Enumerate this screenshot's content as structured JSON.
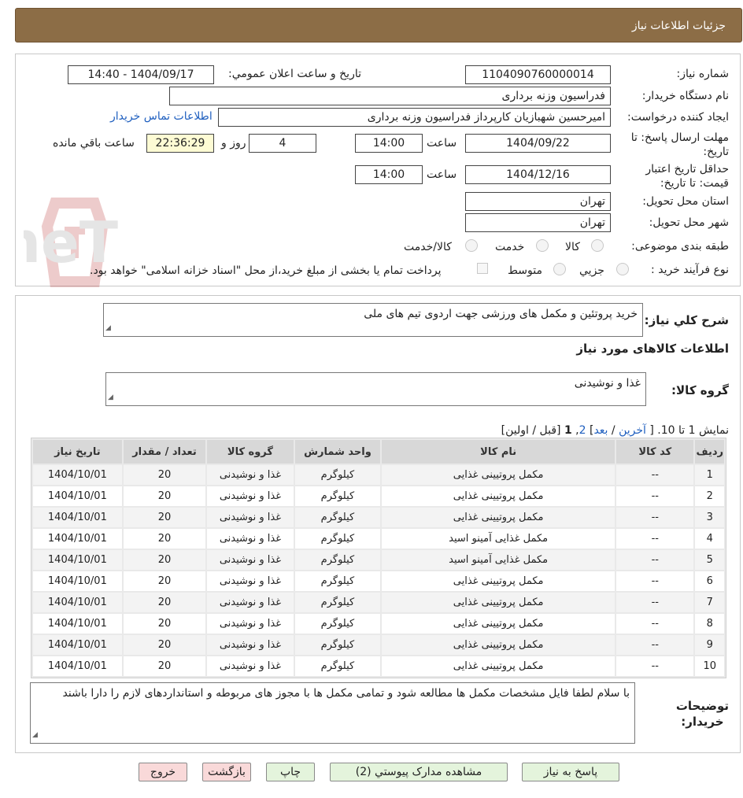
{
  "header": {
    "title": "جزئیات اطلاعات نیاز"
  },
  "form": {
    "need_number_label": "شماره نیاز:",
    "need_number": "1104090760000014",
    "announce_label": "تاریخ و ساعت اعلان عمومي:",
    "announce_value": "1404/09/17 - 14:40",
    "buyer_org_label": "نام دستگاه خريدار:",
    "buyer_org": "فدراسیون وزنه برداری",
    "requester_label": "ايجاد کننده درخواست:",
    "requester": "امیرحسین شهبازیان کارپرداز فدراسیون وزنه برداری",
    "contact_link": "اطلاعات تماس خريدار",
    "reply_deadline_label_1": "مهلت ارسال پاسخ: تا",
    "reply_deadline_label_2": "تاريخ:",
    "reply_date": "1404/09/22",
    "time_label": "ساعت",
    "reply_time": "14:00",
    "days_value": "4",
    "days_label": "روز و",
    "remaining_time": "22:36:29",
    "remaining_label": "ساعت باقي مانده",
    "price_validity_label_1": "حداقل تاريخ اعتبار",
    "price_validity_label_2": "قيمت: تا تاريخ:",
    "price_validity_date": "1404/12/16",
    "price_validity_time": "14:00",
    "province_label": "استان محل تحويل:",
    "province": "تهران",
    "city_label": "شهر محل تحويل:",
    "city": "تهران",
    "category_label": "طبقه بندی موضوعی:",
    "category_options": [
      "کالا",
      "خدمت",
      "کالا/خدمت"
    ],
    "process_label": "نوع فرآيند خريد :",
    "process_options": [
      "جزيي",
      "متوسط"
    ],
    "payment_note": "پرداخت تمام یا بخشی از مبلغ خرید،از محل \"اسناد خزانه اسلامی\" خواهد بود."
  },
  "watermark": {
    "text": "AriaTender.neT"
  },
  "need": {
    "summary_label": "شرح كلي نياز:",
    "summary": "خرید پروتئین و مکمل های ورزشی جهت اردوی تیم های ملی",
    "goods_title": "اطلاعات کالاهای مورد نياز",
    "group_label": "گروه کالا:",
    "group_value": "غذا و نوشیدنی"
  },
  "pager": {
    "showing": "نمایش 1 تا 10.",
    "open": "[",
    "last": "آخرین",
    "sep1": "/",
    "next": "بعد",
    "close_open": "]",
    "page2": "2",
    "comma": ",",
    "page1": "1",
    "tail": "[قبل / اولین]"
  },
  "table": {
    "headers": [
      "رديف",
      "کد کالا",
      "نام کالا",
      "واحد شمارش",
      "گروه کالا",
      "تعداد / مقدار",
      "تاريخ نياز"
    ],
    "rows": [
      [
        "1",
        "--",
        "مکمل پروتیینی غذایی",
        "کیلوگرم",
        "غذا و نوشیدنی",
        "20",
        "1404/10/01"
      ],
      [
        "2",
        "--",
        "مکمل پروتیینی غذایی",
        "کیلوگرم",
        "غذا و نوشیدنی",
        "20",
        "1404/10/01"
      ],
      [
        "3",
        "--",
        "مکمل پروتیینی غذایی",
        "کیلوگرم",
        "غذا و نوشیدنی",
        "20",
        "1404/10/01"
      ],
      [
        "4",
        "--",
        "مکمل غذایی آمینو اسید",
        "کیلوگرم",
        "غذا و نوشیدنی",
        "20",
        "1404/10/01"
      ],
      [
        "5",
        "--",
        "مکمل غذایی آمینو اسید",
        "کیلوگرم",
        "غذا و نوشیدنی",
        "20",
        "1404/10/01"
      ],
      [
        "6",
        "--",
        "مکمل پروتیینی غذایی",
        "کیلوگرم",
        "غذا و نوشیدنی",
        "20",
        "1404/10/01"
      ],
      [
        "7",
        "--",
        "مکمل پروتیینی غذایی",
        "کیلوگرم",
        "غذا و نوشیدنی",
        "20",
        "1404/10/01"
      ],
      [
        "8",
        "--",
        "مکمل پروتیینی غذایی",
        "کیلوگرم",
        "غذا و نوشیدنی",
        "20",
        "1404/10/01"
      ],
      [
        "9",
        "--",
        "مکمل پروتیینی غذایی",
        "کیلوگرم",
        "غذا و نوشیدنی",
        "20",
        "1404/10/01"
      ],
      [
        "10",
        "--",
        "مکمل پروتیینی غذایی",
        "کیلوگرم",
        "غذا و نوشیدنی",
        "20",
        "1404/10/01"
      ]
    ]
  },
  "buyer_notes": {
    "label_1": "توضيحات",
    "label_2": "خريدار:",
    "text": "با سلام لطفا فایل مشخصات مکمل ها مطالعه شود و تمامی مکمل ها با مجوز های مربوطه و استانداردهای لازم را دارا باشند"
  },
  "buttons": {
    "reply": "پاسخ به نياز",
    "attachments": "مشاهده مدارک پيوستي (2)",
    "print": "چاپ",
    "back": "بازگشت",
    "exit": "خروج"
  }
}
